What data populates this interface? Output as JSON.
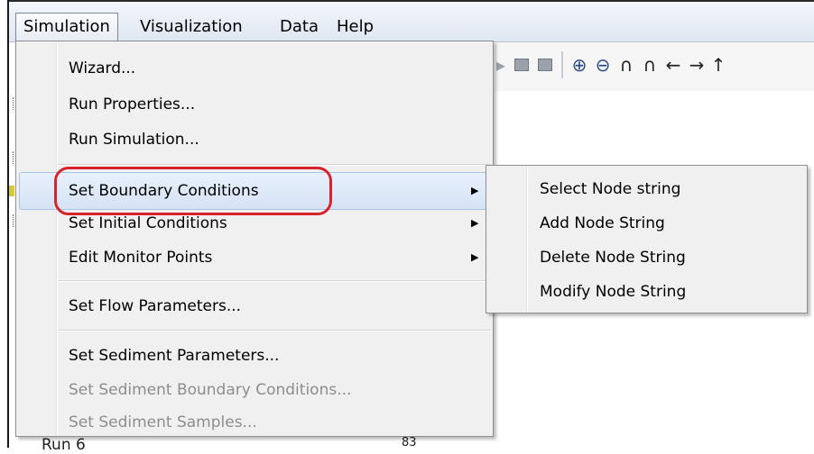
{
  "menubar": {
    "items": [
      "Simulation",
      "Visualization",
      "Data",
      "Help"
    ]
  },
  "toolbar": {
    "icons": [
      "copy-icon",
      "paste-icon",
      "zoom-in-icon",
      "zoom-out-icon",
      "pan-up-icon",
      "pan-up-alt-icon",
      "arrow-left-icon",
      "arrow-right-icon",
      "arrow-up-icon"
    ]
  },
  "background": {
    "bottom_item": "Run 6",
    "bottom_item_right": "83"
  },
  "simulation_menu": {
    "items": [
      {
        "label": "Wizard...",
        "enabled": true,
        "submenu": false
      },
      {
        "label": "Run Properties...",
        "enabled": true,
        "submenu": false
      },
      {
        "label": "Run Simulation...",
        "enabled": true,
        "submenu": false
      },
      {
        "label": "Set Boundary Conditions",
        "enabled": true,
        "submenu": true,
        "highlighted": true
      },
      {
        "label": "Set Initial Conditions",
        "enabled": true,
        "submenu": true
      },
      {
        "label": "Edit Monitor Points",
        "enabled": true,
        "submenu": true
      },
      {
        "label": "Set Flow Parameters...",
        "enabled": true,
        "submenu": false
      },
      {
        "label": "Set Sediment Parameters...",
        "enabled": true,
        "submenu": false
      },
      {
        "label": "Set Sediment Boundary Conditions...",
        "enabled": false,
        "submenu": false
      },
      {
        "label": "Set Sediment Samples...",
        "enabled": false,
        "submenu": false
      }
    ],
    "submenu_arrow": "▶"
  },
  "boundary_submenu": {
    "items": [
      "Select Node string",
      "Add Node String",
      "Delete Node String",
      "Modify Node String"
    ]
  },
  "colors": {
    "highlight_border": "#d8232a",
    "disabled_text": "#8d8d8d"
  }
}
